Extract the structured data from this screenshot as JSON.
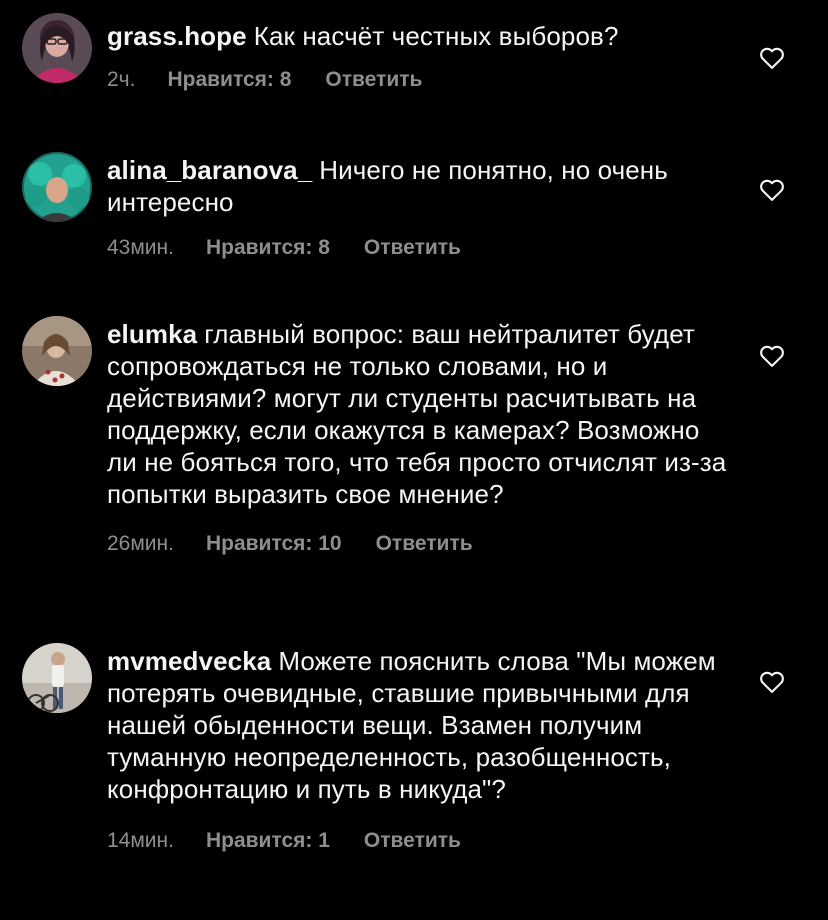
{
  "colors": {
    "background": "#000000",
    "text": "#f5f5f5",
    "meta": "#8e8e8e"
  },
  "comments": [
    {
      "username": "grass.hope",
      "text": "Как насчёт честных выборов?",
      "time": "2ч.",
      "likes": "Нравится: 8",
      "reply": "Ответить",
      "icon": "heart-outline-icon"
    },
    {
      "username": "alina_baranova_",
      "text": "Ничего не понятно, но очень интересно",
      "time": "43мин.",
      "likes": "Нравится: 8",
      "reply": "Ответить",
      "icon": "heart-outline-icon"
    },
    {
      "username": "elumka",
      "text": "главный вопрос: ваш нейтралитет будет сопровождаться не только словами, но и действиями? могут ли студенты расчитывать на поддержку, если окажутся в камерах? Возможно ли не бояться того, что тебя просто отчислят из-за попытки выразить свое мнение?",
      "time": "26мин.",
      "likes": "Нравится: 10",
      "reply": "Ответить",
      "icon": "heart-outline-icon"
    },
    {
      "username": "mvmedvecka",
      "text": "Можете пояснить слова \"Мы можем потерять очевидные, ставшие привычными для нашей обыденности вещи. Взамен получим туманную неопределенность, разобщенность, конфронтацию и путь в никуда\"?",
      "time": "14мин.",
      "likes": "Нравится: 1",
      "reply": "Ответить",
      "icon": "heart-outline-icon"
    }
  ]
}
